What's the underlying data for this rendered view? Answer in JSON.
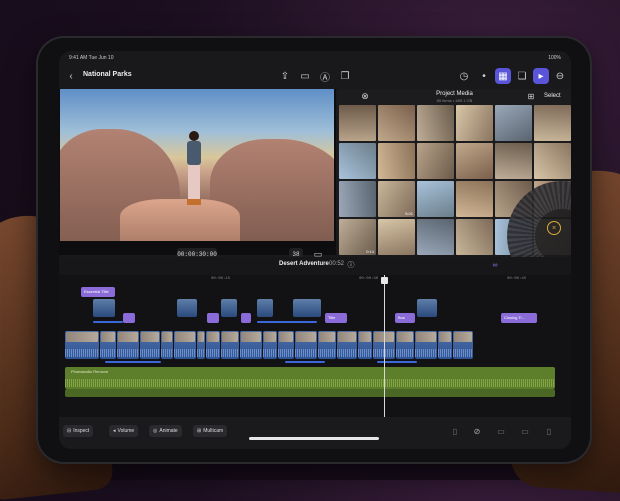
{
  "status_bar": {
    "time": "9:41 AM Tue Jun 10",
    "battery": "100%"
  },
  "top_bar": {
    "title": "National Parks",
    "icons": [
      "back-chevron-icon",
      "share-icon",
      "camera-icon",
      "voiceover-icon",
      "copy-icon",
      "history-icon",
      "photos-icon",
      "layers-icon",
      "record-icon",
      "more-icon"
    ]
  },
  "viewer": {
    "timecode": "00:00:30:00",
    "zoom": "38"
  },
  "media_browser": {
    "title": "Project Media",
    "subtitle": "85 items • 489.1 GB",
    "select_label": "Select",
    "thumb_durations": [
      "",
      "",
      "",
      "",
      "",
      "",
      "",
      "",
      "",
      "",
      "",
      "",
      "",
      "5:01",
      "",
      "",
      "",
      "",
      "0:14",
      "",
      "",
      "",
      "",
      "",
      "",
      "",
      "",
      "",
      "",
      ""
    ]
  },
  "timeline": {
    "project_title": "Desert Adventure",
    "duration": "00:52",
    "ruler": [
      "00:00:15",
      "00:00:30",
      "00:00:45"
    ],
    "title_clips": [
      "Essential Title",
      "",
      "",
      "",
      "Title",
      "Bus",
      "Closing Ti..."
    ],
    "audio_label": "Photostudio Remove"
  },
  "bottom_toolbar": {
    "buttons": [
      {
        "label": "Inspect",
        "icon": "inspect-icon"
      },
      {
        "label": "Volume",
        "icon": "volume-icon"
      },
      {
        "label": "Animate",
        "icon": "animate-icon"
      },
      {
        "label": "Multicam",
        "icon": "multicam-icon"
      }
    ]
  },
  "colors": {
    "accent": "#5a55d8",
    "title_clip": "#8b6bd8",
    "video_clip": "#2f5596",
    "audio_clip": "#5d7e2b"
  }
}
